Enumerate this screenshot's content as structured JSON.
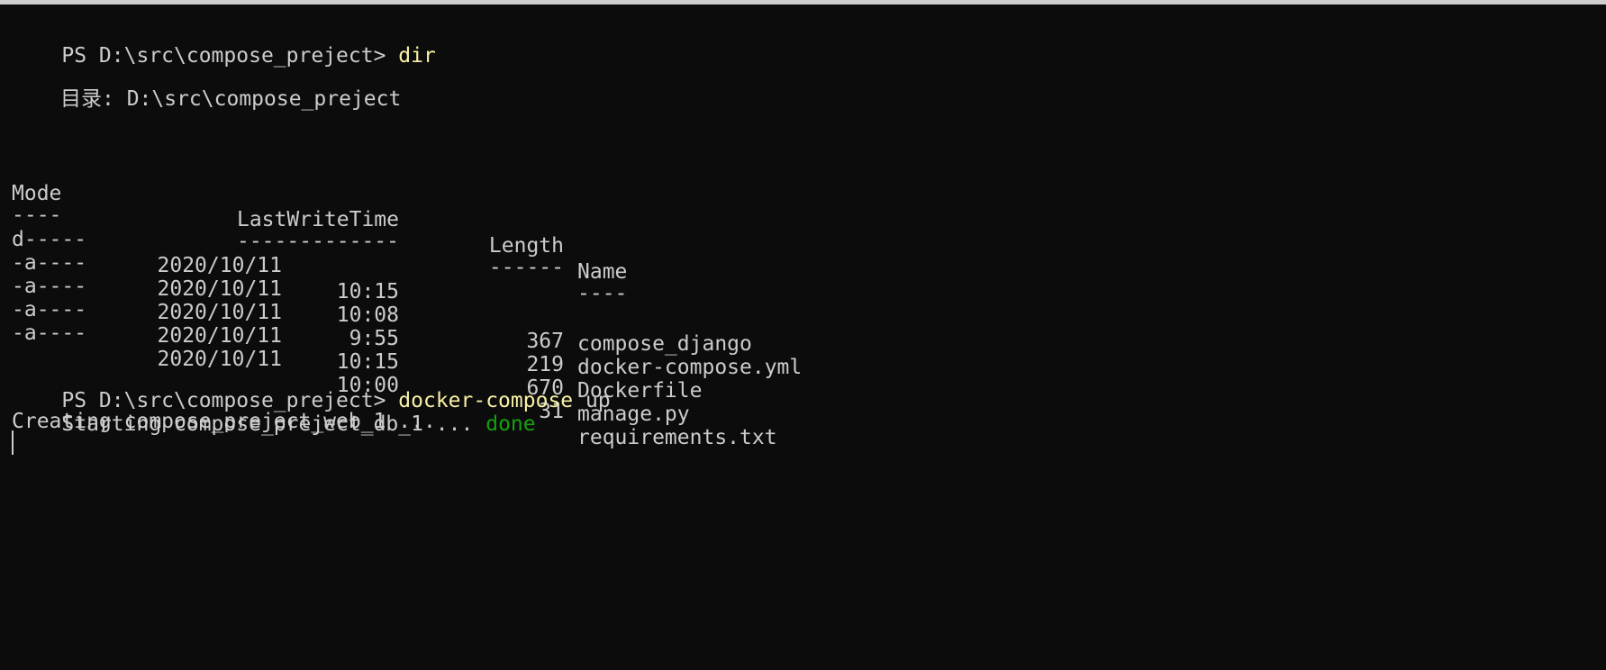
{
  "terminal": {
    "prompt1": "PS D:\\src\\compose_preject>",
    "command1": "dir",
    "directory_label": "目录: D:\\src\\compose_preject",
    "headers": {
      "mode": "Mode",
      "lastwritetime": "LastWriteTime",
      "length": "Length",
      "name": "Name"
    },
    "separators": {
      "mode": "----",
      "lastwritetime": "-------------",
      "length": "------",
      "name": "----"
    },
    "entries": [
      {
        "mode": "d-----",
        "date": "2020/10/11",
        "time": "10:15",
        "length": "",
        "name": "compose_django"
      },
      {
        "mode": "-a----",
        "date": "2020/10/11",
        "time": "10:08",
        "length": "367",
        "name": "docker-compose.yml"
      },
      {
        "mode": "-a----",
        "date": "2020/10/11",
        "time": "9:55",
        "length": "219",
        "name": "Dockerfile"
      },
      {
        "mode": "-a----",
        "date": "2020/10/11",
        "time": "10:15",
        "length": "670",
        "name": "manage.py"
      },
      {
        "mode": "-a----",
        "date": "2020/10/11",
        "time": "10:00",
        "length": "31",
        "name": "requirements.txt"
      }
    ],
    "prompt2": "PS D:\\src\\compose_preject>",
    "command2": "docker-compose",
    "command2_args": "up",
    "output": {
      "starting_text": "Starting compose_preject_db_1 ...",
      "starting_status": "done",
      "creating_text": "Creating compose_preject_web_1 ..."
    }
  },
  "colors": {
    "background": "#0c0c0c",
    "foreground": "#cccccc",
    "command": "#f9f1a5",
    "success": "#13a10e"
  }
}
